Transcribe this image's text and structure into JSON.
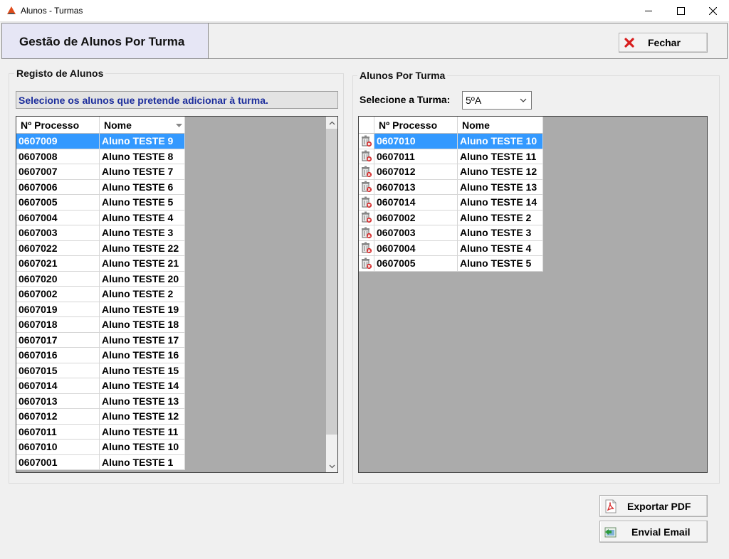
{
  "window": {
    "title": "Alunos - Turmas"
  },
  "header": {
    "title": "Gestão de Alunos Por Turma",
    "close_label": "Fechar"
  },
  "registo": {
    "legend": "Registo de Alunos",
    "instruction": "Selecione os alunos que pretende adicionar à turma.",
    "columns": [
      "Nº Processo",
      "Nome"
    ],
    "rows": [
      {
        "num": "0607009",
        "nome": "Aluno TESTE 9"
      },
      {
        "num": "0607008",
        "nome": "Aluno TESTE 8"
      },
      {
        "num": "0607007",
        "nome": "Aluno TESTE 7"
      },
      {
        "num": "0607006",
        "nome": "Aluno TESTE 6"
      },
      {
        "num": "0607005",
        "nome": "Aluno TESTE 5"
      },
      {
        "num": "0607004",
        "nome": "Aluno TESTE 4"
      },
      {
        "num": "0607003",
        "nome": "Aluno TESTE 3"
      },
      {
        "num": "0607022",
        "nome": "Aluno TESTE 22"
      },
      {
        "num": "0607021",
        "nome": "Aluno TESTE 21"
      },
      {
        "num": "0607020",
        "nome": "Aluno TESTE 20"
      },
      {
        "num": "0607002",
        "nome": "Aluno TESTE 2"
      },
      {
        "num": "0607019",
        "nome": "Aluno TESTE 19"
      },
      {
        "num": "0607018",
        "nome": "Aluno TESTE 18"
      },
      {
        "num": "0607017",
        "nome": "Aluno TESTE 17"
      },
      {
        "num": "0607016",
        "nome": "Aluno TESTE 16"
      },
      {
        "num": "0607015",
        "nome": "Aluno TESTE 15"
      },
      {
        "num": "0607014",
        "nome": "Aluno TESTE 14"
      },
      {
        "num": "0607013",
        "nome": "Aluno TESTE 13"
      },
      {
        "num": "0607012",
        "nome": "Aluno TESTE 12"
      },
      {
        "num": "0607011",
        "nome": "Aluno TESTE 11"
      },
      {
        "num": "0607010",
        "nome": "Aluno TESTE 10"
      },
      {
        "num": "0607001",
        "nome": "Aluno TESTE 1"
      }
    ],
    "selected_index": 0
  },
  "turma": {
    "legend": "Alunos Por Turma",
    "select_label": "Selecione a Turma:",
    "select_value": "5ºA",
    "columns": [
      "Nº Processo",
      "Nome"
    ],
    "rows": [
      {
        "num": "0607010",
        "nome": "Aluno TESTE 10"
      },
      {
        "num": "0607011",
        "nome": "Aluno TESTE 11"
      },
      {
        "num": "0607012",
        "nome": "Aluno TESTE 12"
      },
      {
        "num": "0607013",
        "nome": "Aluno TESTE 13"
      },
      {
        "num": "0607014",
        "nome": "Aluno TESTE 14"
      },
      {
        "num": "0607002",
        "nome": "Aluno TESTE 2"
      },
      {
        "num": "0607003",
        "nome": "Aluno TESTE 3"
      },
      {
        "num": "0607004",
        "nome": "Aluno TESTE 4"
      },
      {
        "num": "0607005",
        "nome": "Aluno TESTE 5"
      }
    ],
    "selected_index": 0,
    "row_icon": "delete-trash-icon"
  },
  "actions": {
    "export_pdf": "Exportar PDF",
    "send_email": "Envial Email"
  },
  "colors": {
    "selection": "#3399ff",
    "instruction_text": "#1c2d9c",
    "grid_background": "#ababab",
    "header_title_bg": "#e6e6f5"
  }
}
